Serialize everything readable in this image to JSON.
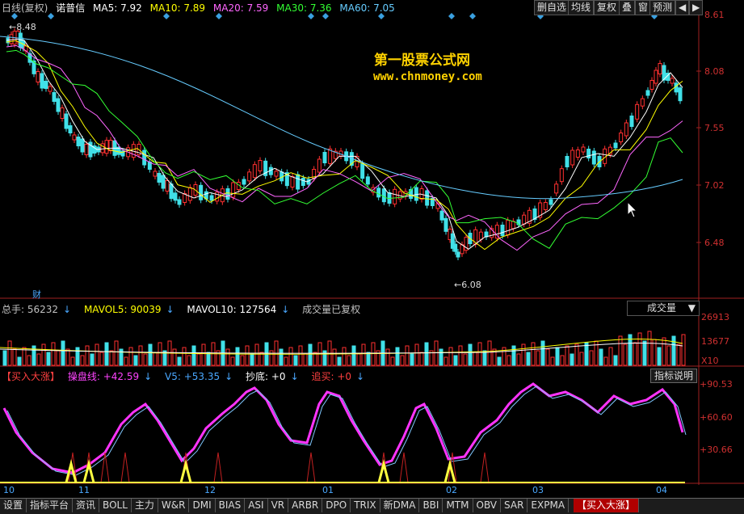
{
  "main_header": {
    "title": "日线(复权)",
    "stock": "诺普信",
    "ma5": "MA5: 7.92",
    "ma10": "MA10: 7.89",
    "ma20": "MA20: 7.59",
    "ma30": "MA30: 7.36",
    "ma60": "MA60: 7.05",
    "colors": {
      "ma5": "#ffffff",
      "ma10": "#ffff00",
      "ma20": "#ff66ff",
      "ma30": "#33ff33",
      "ma60": "#66ccff"
    }
  },
  "toolbar": {
    "buttons": [
      "删自选",
      "均线",
      "复权",
      "叠",
      "窗",
      "预测"
    ],
    "nav_left": "◀",
    "nav_right": "▶"
  },
  "price_axis": [
    "8.61",
    "8.08",
    "7.55",
    "7.02",
    "6.48"
  ],
  "annotations": {
    "high_label": "8.48",
    "low_label": "6.08",
    "fin_marker": "财"
  },
  "watermark": {
    "line1": "第一股票公式网",
    "line2": "www.chnmoney.com"
  },
  "volume": {
    "total": "总手: 56232",
    "mavol5": "MAVOL5: 90039",
    "mavol10": "MAVOL10: 127564",
    "note": "成交量已复权",
    "selector": "成交量",
    "axis": [
      "26913",
      "13677",
      "X10"
    ]
  },
  "indicator": {
    "name": "【买入大涨】",
    "line1": "操盘线: +42.59",
    "line2": "V5: +53.35",
    "line3": "抄底: +0",
    "line4": "追买: +0",
    "help_button": "指标说明",
    "axis": [
      "+90.53",
      "+60.60",
      "+30.66"
    ]
  },
  "x_axis": [
    "10",
    "11",
    "12",
    "01",
    "02",
    "03",
    "04"
  ],
  "bottom_tabs": [
    "设置",
    "指标平台",
    "资讯",
    "BOLL",
    "主力",
    "W&R",
    "DMI",
    "BIAS",
    "ASI",
    "VR",
    "ARBR",
    "DPO",
    "TRIX",
    "新DMA",
    "BBI",
    "MTM",
    "OBV",
    "SAR",
    "EXPMA",
    "【买入大涨】"
  ]
}
